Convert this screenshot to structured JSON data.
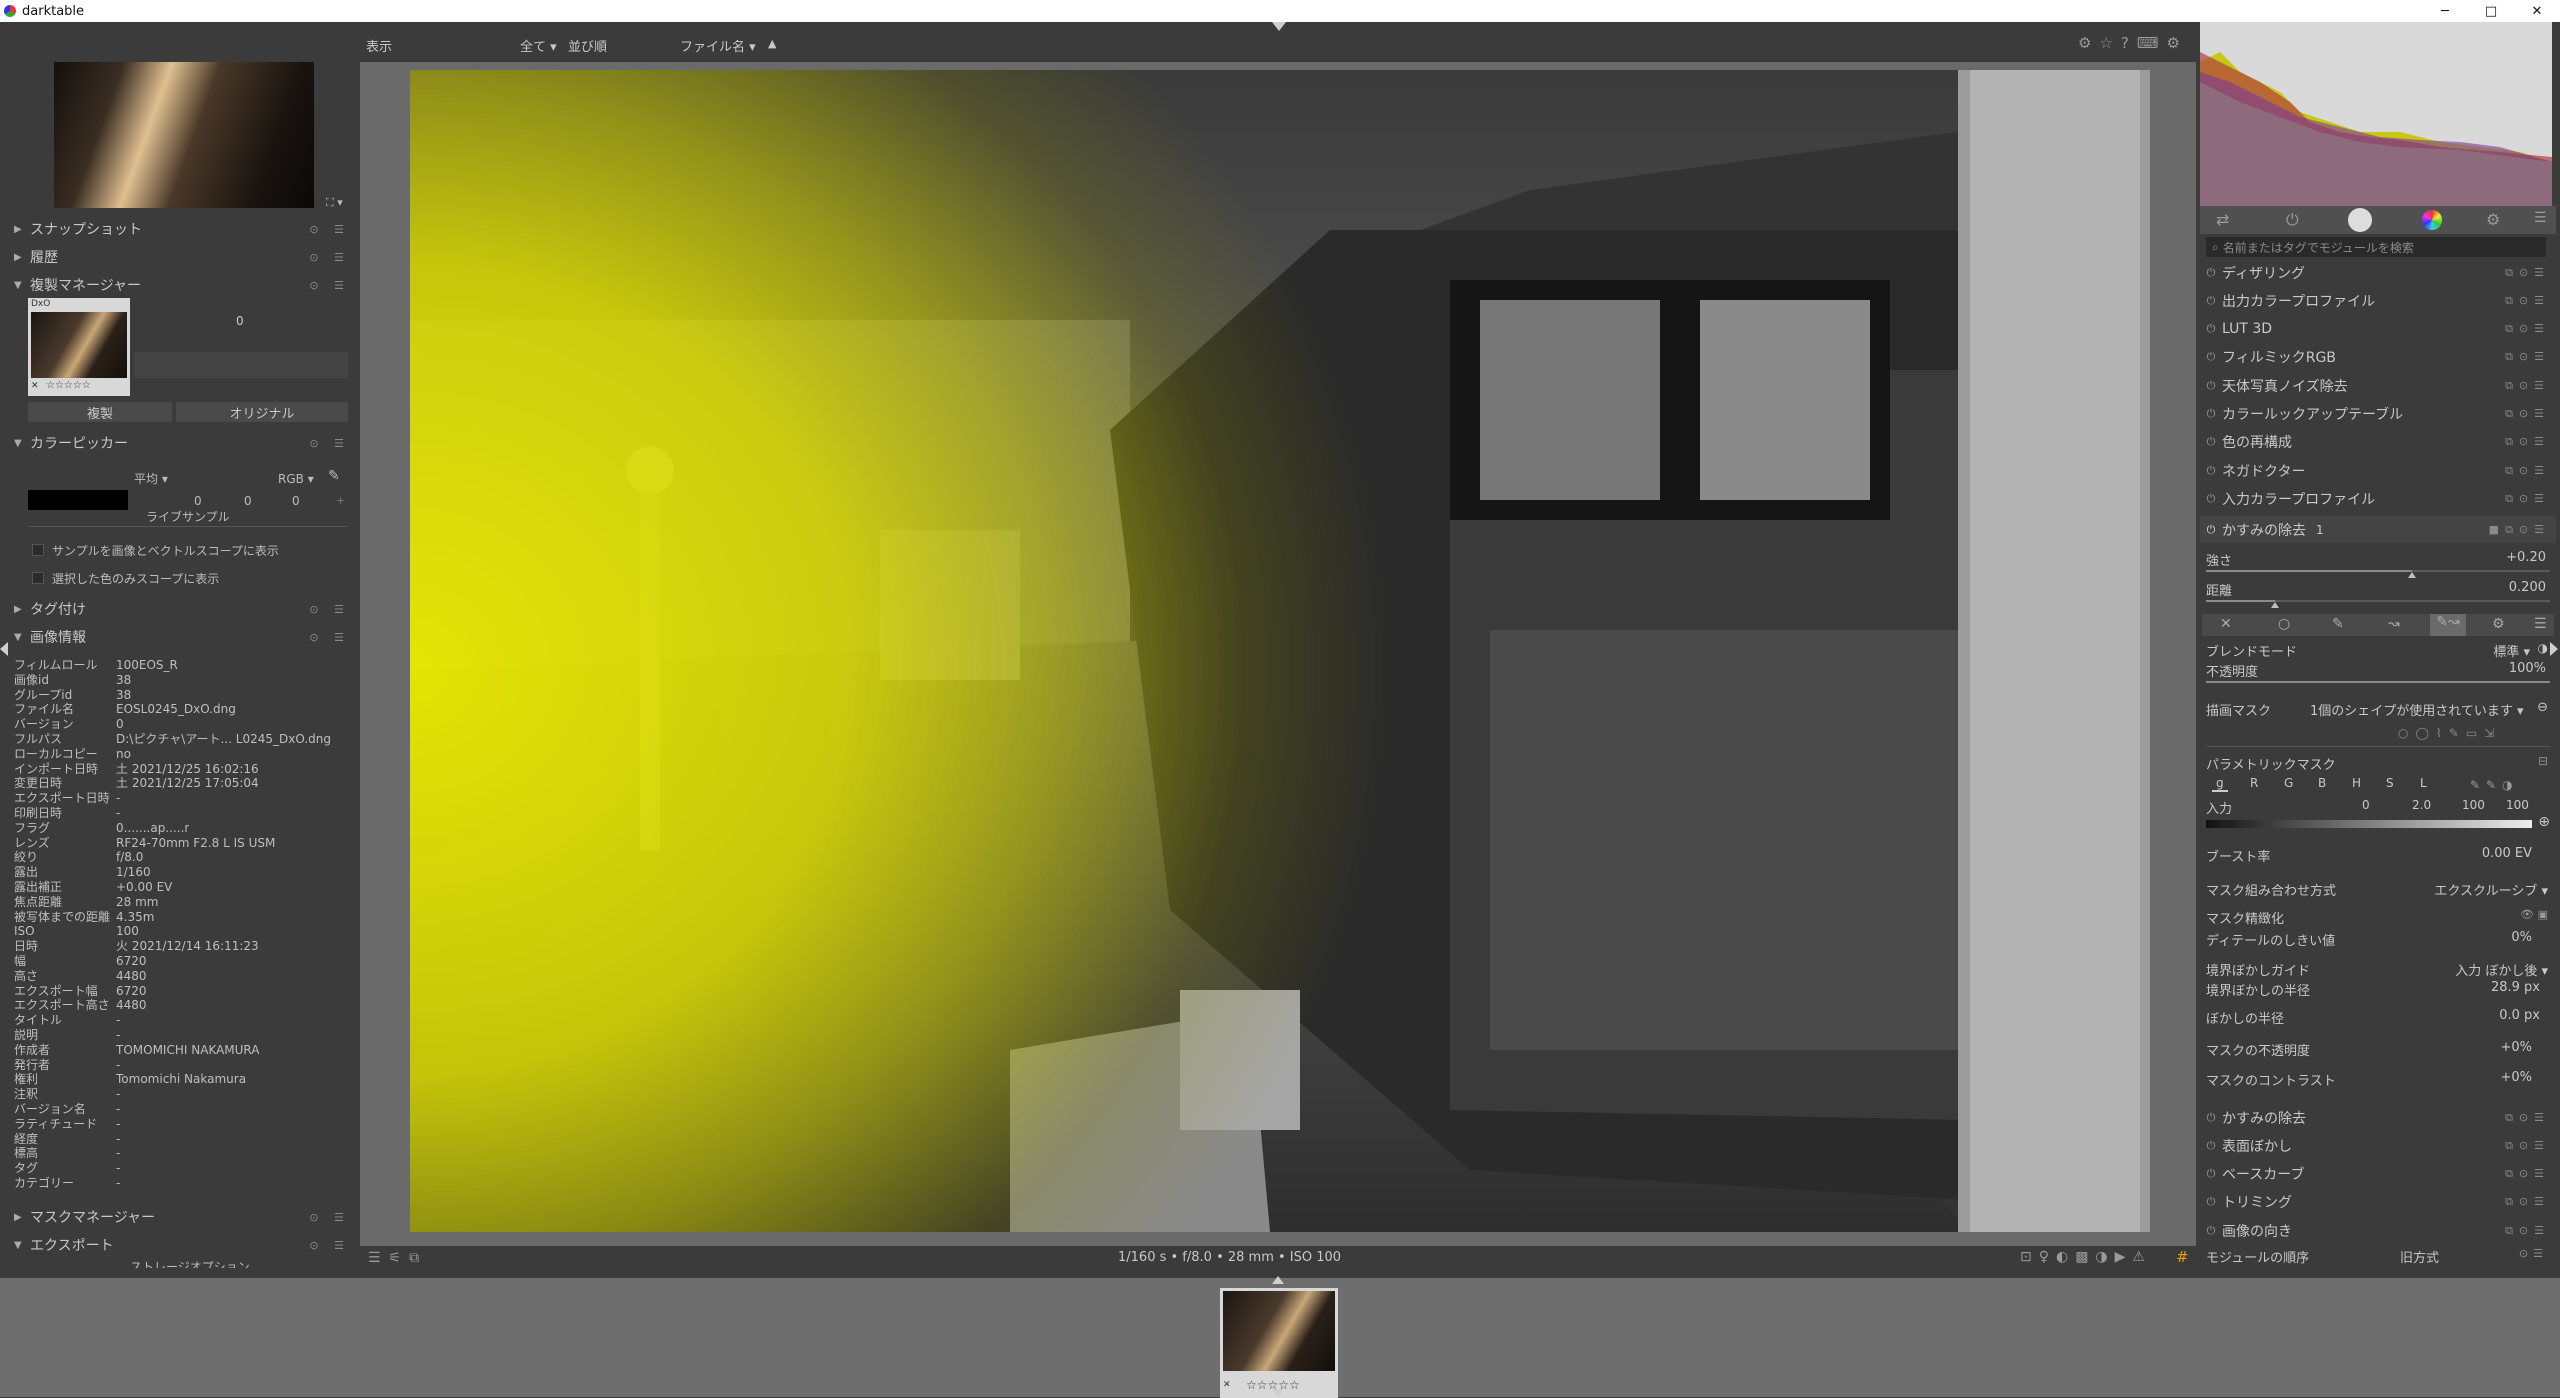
{
  "window": {
    "title": "darktable",
    "min": "─",
    "max": "□",
    "close": "✕"
  },
  "topbar": {
    "view_label": "表示",
    "filter_all": "全て",
    "sort_label": "並び順",
    "sort_field": "ファイル名",
    "sort_dir": "▲"
  },
  "left": {
    "snapshots": "スナップショット",
    "history": "履歴",
    "duplicate_manager": "複製マネージャー",
    "dup_count": "0",
    "dup_badge": "DxO",
    "dup_stars": "☆☆☆☆☆",
    "duplicate_btn": "複製",
    "original_btn": "オリジナル",
    "color_picker": "カラーピッカー",
    "picker_mode": "平均",
    "picker_space": "RGB",
    "picker_vals": [
      "0",
      "0",
      "0"
    ],
    "live_sample": "ライブサンプル",
    "show_sample": "サンプルを画像とベクトルスコープに表示",
    "show_selected": "選択した色のみスコープに表示",
    "tagging": "タグ付け",
    "image_info": "画像情報",
    "info_rows": [
      {
        "k": "フィルムロール",
        "v": "100EOS_R"
      },
      {
        "k": "画像id",
        "v": "38"
      },
      {
        "k": "グループid",
        "v": "38"
      },
      {
        "k": "ファイル名",
        "v": "EOSL0245_DxO.dng"
      },
      {
        "k": "バージョン",
        "v": "0"
      },
      {
        "k": "フルパス",
        "v": "D:\\ピクチャ\\アート... L0245_DxO.dng"
      },
      {
        "k": "ローカルコピー",
        "v": "no"
      },
      {
        "k": "インポート日時",
        "v": "土 2021/12/25 16:02:16"
      },
      {
        "k": "変更日時",
        "v": "土 2021/12/25 17:05:04"
      },
      {
        "k": "エクスポート日時",
        "v": "-"
      },
      {
        "k": "印刷日時",
        "v": "-"
      },
      {
        "k": "フラグ",
        "v": "0.......ap.....r"
      },
      {
        "k": "レンズ",
        "v": "RF24-70mm F2.8 L IS USM"
      },
      {
        "k": "絞り",
        "v": "f/8.0"
      },
      {
        "k": "露出",
        "v": "1/160"
      },
      {
        "k": "露出補正",
        "v": "+0.00 EV"
      },
      {
        "k": "焦点距離",
        "v": "28 mm"
      },
      {
        "k": "被写体までの距離",
        "v": "4.35m"
      },
      {
        "k": "ISO",
        "v": "100"
      },
      {
        "k": "日時",
        "v": "火 2021/12/14 16:11:23"
      },
      {
        "k": "幅",
        "v": "6720"
      },
      {
        "k": "高さ",
        "v": "4480"
      },
      {
        "k": "エクスポート幅",
        "v": "6720"
      },
      {
        "k": "エクスポート高さ",
        "v": "4480"
      },
      {
        "k": "タイトル",
        "v": "-"
      },
      {
        "k": "説明",
        "v": "-"
      },
      {
        "k": "作成者",
        "v": "TOMOMICHI NAKAMURA"
      },
      {
        "k": "発行者",
        "v": "-"
      },
      {
        "k": "権利",
        "v": "Tomomichi Nakamura"
      },
      {
        "k": "注釈",
        "v": "-"
      },
      {
        "k": "バージョン名",
        "v": "-"
      },
      {
        "k": "ラティチュード",
        "v": "-"
      },
      {
        "k": "経度",
        "v": "-"
      },
      {
        "k": "標高",
        "v": "-"
      },
      {
        "k": "タグ",
        "v": "-"
      },
      {
        "k": "カテゴリー",
        "v": "-"
      }
    ],
    "mask_manager": "マスクマネージャー",
    "export": "エクスポート",
    "export_sub": "ストレージオプション"
  },
  "center": {
    "exif_line": "1/160 s • f/8.0 • 28 mm • ISO 100"
  },
  "right": {
    "search_placeholder": "名前またはタグでモジュールを検索",
    "modules_top": [
      "ディザリング",
      "出力カラープロファイル",
      "LUT 3D",
      "フィルミックRGB",
      "天体写真ノイズ除去",
      "カラールックアップテーブル",
      "色の再構成",
      "ネガドクター",
      "入力カラープロファイル"
    ],
    "haze_title": "かすみの除去",
    "haze_instance": "1",
    "strength_label": "強さ",
    "strength_val": "+0.20",
    "strength_level": 0.6,
    "distance_label": "距離",
    "distance_val": "0.200",
    "distance_level": 0.2,
    "blend_mode_label": "ブレンドモード",
    "blend_mode_val": "標準",
    "opacity_label": "不透明度",
    "opacity_val": "100%",
    "drawn_mask_label": "描画マスク",
    "drawn_mask_val": "1個のシェイプが使用されています",
    "param_mask": "パラメトリックマスク",
    "channels": [
      "g",
      "R",
      "G",
      "B",
      "H",
      "S",
      "L"
    ],
    "input_label": "入力",
    "input_vals": [
      "0",
      "2.0",
      "100",
      "100"
    ],
    "boost_label": "ブースト率",
    "boost_val": "0.00 EV",
    "combine_label": "マスク組み合わせ方式",
    "combine_val": "エクスクルーシブ",
    "refine_label": "マスク精緻化",
    "detail_label": "ディテールのしきい値",
    "detail_val": "0%",
    "feather_guide_label": "境界ぼかしガイド",
    "feather_guide_val": "入力 ぼかし後",
    "feather_radius_label": "境界ぼかしの半径",
    "feather_radius_val": "28.9 px",
    "blur_radius_label": "ぼかしの半径",
    "blur_radius_val": "0.0 px",
    "mask_opacity_label": "マスクの不透明度",
    "mask_opacity_val": "+0%",
    "mask_contrast_label": "マスクのコントラスト",
    "mask_contrast_val": "+0%",
    "modules_bottom": [
      "かすみの除去",
      "表面ぼかし",
      "ベースカーブ",
      "トリミング",
      "画像の向き"
    ],
    "module_order_label": "モジュールの順序",
    "module_order_val": "旧方式"
  },
  "filmstrip": {
    "stars": "☆☆☆☆☆",
    "reject": "✕"
  },
  "colors": {
    "mask_yellow": "#e8e800",
    "panel": "#3b3b3b",
    "center_bg": "#6a6a6a"
  }
}
